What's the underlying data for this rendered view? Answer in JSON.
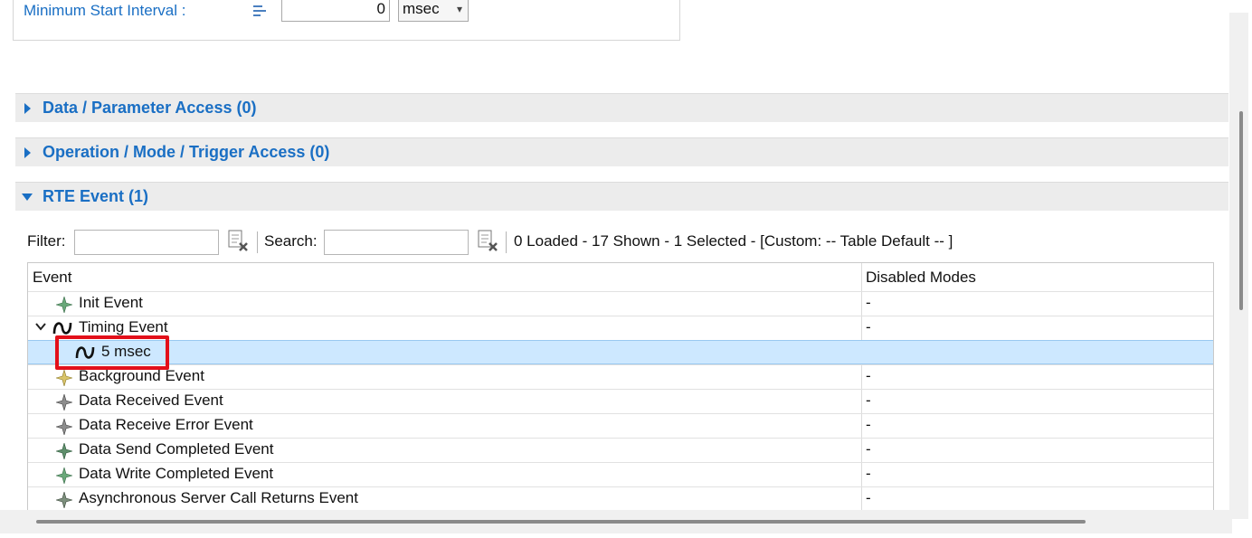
{
  "top_form": {
    "min_start_label": "Minimum Start Interval :",
    "min_start_value": "0",
    "min_start_unit": "msec"
  },
  "sections": {
    "data_access": "Data / Parameter Access (0)",
    "operation_access": "Operation / Mode / Trigger Access (0)",
    "rte_event": "RTE Event (1)"
  },
  "filter_bar": {
    "filter_label": "Filter:",
    "filter_value": "",
    "search_label": "Search:",
    "search_value": "",
    "status_text": "0 Loaded - 17 Shown - 1 Selected -  [Custom: -- Table Default -- ]"
  },
  "table": {
    "columns": {
      "event": "Event",
      "disabled_modes": "Disabled Modes"
    },
    "rows": [
      {
        "label": "Init Event",
        "mode": "-",
        "icon": "star-green-icon"
      },
      {
        "label": "Timing Event",
        "mode": "-",
        "icon": "timing-wave-icon"
      },
      {
        "label": "5 msec",
        "mode": "",
        "icon": "timing-wave-icon"
      },
      {
        "label": "Background Event",
        "mode": "-",
        "icon": "star-yellow-icon"
      },
      {
        "label": "Data Received Event",
        "mode": "-",
        "icon": "star-gray-icon"
      },
      {
        "label": "Data Receive Error Event",
        "mode": "-",
        "icon": "star-gray-icon"
      },
      {
        "label": "Data Send Completed Event",
        "mode": "-",
        "icon": "star-green-icon"
      },
      {
        "label": "Data Write Completed Event",
        "mode": "-",
        "icon": "star-green-icon"
      },
      {
        "label": "Asynchronous Server Call Returns Event",
        "mode": "-",
        "icon": "star-gray-icon"
      }
    ]
  },
  "colors": {
    "link_blue": "#1a6fc4",
    "selected_row": "#cde8ff",
    "highlight_red": "#e3101a"
  }
}
